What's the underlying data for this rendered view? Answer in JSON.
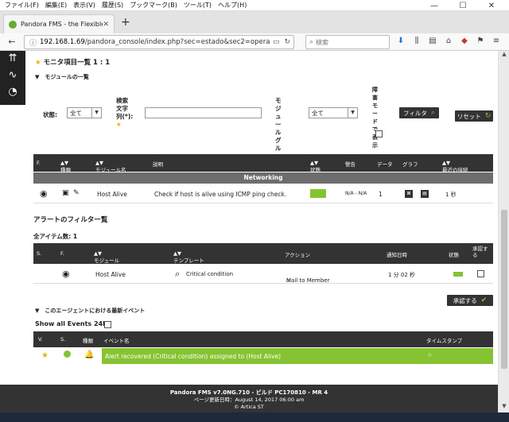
{
  "browser": {
    "menu": [
      "ファイル(F)",
      "編集(E)",
      "表示(V)",
      "履歴(S)",
      "ブックマーク(B)",
      "ツール(T)",
      "ヘルプ(H)"
    ],
    "tab_title": "Pandora FMS - the Flexible M",
    "url_host": "192.168.1.69",
    "url_path": "/pandora_console/index.php?sec=estado&sec2=operation/",
    "search_placeholder": "検索",
    "extension_badge": "1"
  },
  "monitor": {
    "title": "モニタ項目一覧 1 : 1",
    "module_list_label": "モジュールの一覧",
    "filter": {
      "status_label": "状態:",
      "status_value": "全て",
      "search_label": "検索文字列(*):",
      "group_label": "モジュールグループ",
      "group_value": "全て",
      "show_disabled_label": "障害モードで表示",
      "filter_button": "フィルタ",
      "reset_button": "リセット"
    },
    "columns": [
      "F.",
      "種類",
      "モジュール名",
      "説明",
      "状態",
      "警告",
      "データ",
      "グラフ",
      "最近の接続"
    ],
    "group_name": "Networking",
    "row": {
      "module_name": "Host Alive",
      "description": "Check if host is alive using ICMP ping check.",
      "warning": "N/A - N/A",
      "data": "1",
      "last_contact": "1 秒"
    }
  },
  "alerts": {
    "title": "アラートのフィルター覧",
    "total_label": "全アイテム数: 1",
    "columns": [
      "S.",
      "F.",
      "モジュール",
      "テンプレート",
      "アクション",
      "通知日時",
      "状態",
      "承認する"
    ],
    "row": {
      "module": "Host Alive",
      "template": "Critical condition",
      "action": "Mail to Member",
      "fired": "1 分 02 秒"
    },
    "validate_button": "承認する"
  },
  "events": {
    "title": "このエージェントにおける最新イベント",
    "show_all_label": "Show all Events 24h",
    "columns": [
      "V.",
      "S.",
      "種類",
      "イベント名",
      "タイムスタンプ"
    ],
    "row": {
      "name": "Alert recovered (Critical condition) assigned to (Host Alive)"
    }
  },
  "footer": {
    "version": "Pandora FMS v7.0NG.710 - ビルド PC170810 - MR 4",
    "generated": "ページ更新日時：August 14, 2017 06:00 am",
    "copyright": "© Artica ST"
  },
  "colors": {
    "ok_green": "#86c332",
    "header_dark": "#333333",
    "group_gray": "#6d6d6d",
    "star": "#e8b400"
  }
}
